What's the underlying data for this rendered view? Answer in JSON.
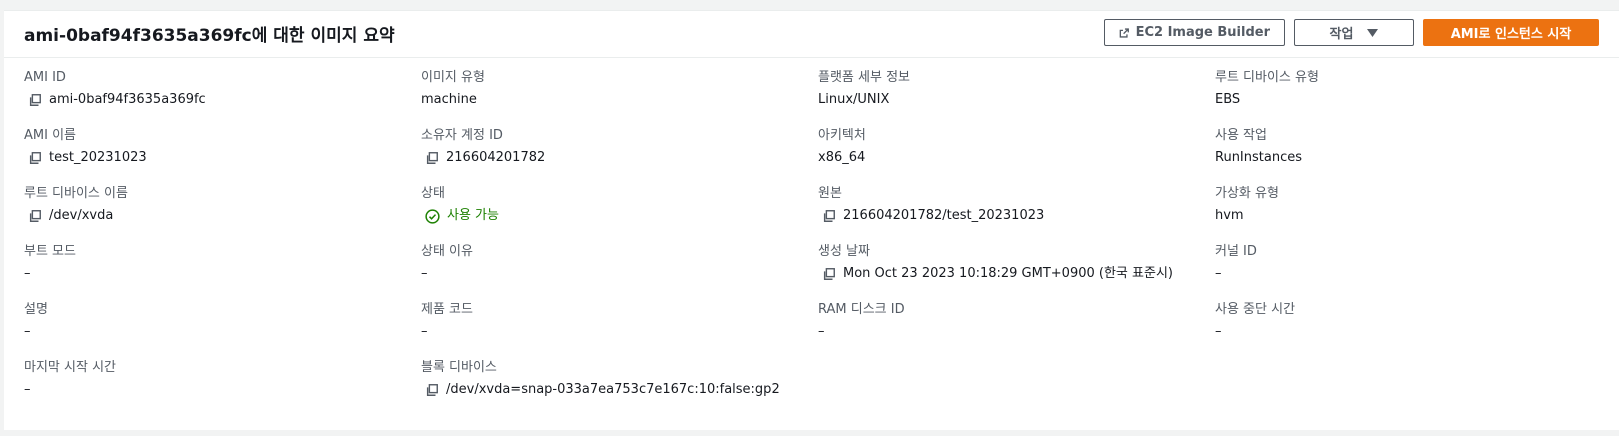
{
  "header": {
    "title": "ami-0baf94f3635a369fc에 대한 이미지 요약",
    "image_builder_label": "EC2 Image Builder",
    "actions_label": "작업",
    "launch_label": "AMI로 인스턴스 시작"
  },
  "colors": {
    "primary": "#ec7211",
    "success": "#1d8102",
    "label": "#545b64"
  },
  "fields": {
    "ami_id": {
      "label": "AMI ID",
      "value": "ami-0baf94f3635a369fc"
    },
    "image_type": {
      "label": "이미지 유형",
      "value": "machine"
    },
    "platform": {
      "label": "플랫폼 세부 정보",
      "value": "Linux/UNIX"
    },
    "root_device_type": {
      "label": "루트 디바이스 유형",
      "value": "EBS"
    },
    "ami_name": {
      "label": "AMI 이름",
      "value": "test_20231023"
    },
    "owner_id": {
      "label": "소유자 계정 ID",
      "value": "216604201782"
    },
    "architecture": {
      "label": "아키텍처",
      "value": "x86_64"
    },
    "usage_operation": {
      "label": "사용 작업",
      "value": "RunInstances"
    },
    "root_device_name": {
      "label": "루트 디바이스 이름",
      "value": "/dev/xvda"
    },
    "state": {
      "label": "상태",
      "value": "사용 가능"
    },
    "source": {
      "label": "원본",
      "value": "216604201782/test_20231023"
    },
    "virtualization": {
      "label": "가상화 유형",
      "value": "hvm"
    },
    "boot_mode": {
      "label": "부트 모드",
      "value": "–"
    },
    "state_reason": {
      "label": "상태 이유",
      "value": "–"
    },
    "creation_date": {
      "label": "생성 날짜",
      "value": "Mon Oct 23 2023 10:18:29 GMT+0900 (한국 표준시)"
    },
    "kernel_id": {
      "label": "커널 ID",
      "value": "–"
    },
    "description": {
      "label": "설명",
      "value": "–"
    },
    "product_code": {
      "label": "제품 코드",
      "value": "–"
    },
    "ram_disk_id": {
      "label": "RAM 디스크 ID",
      "value": "–"
    },
    "deprecation_time": {
      "label": "사용 중단 시간",
      "value": "–"
    },
    "last_launch_time": {
      "label": "마지막 시작 시간",
      "value": "–"
    },
    "block_devices": {
      "label": "블록 디바이스",
      "value": "/dev/xvda=snap-033a7ea753c7e167c:10:false:gp2"
    }
  }
}
